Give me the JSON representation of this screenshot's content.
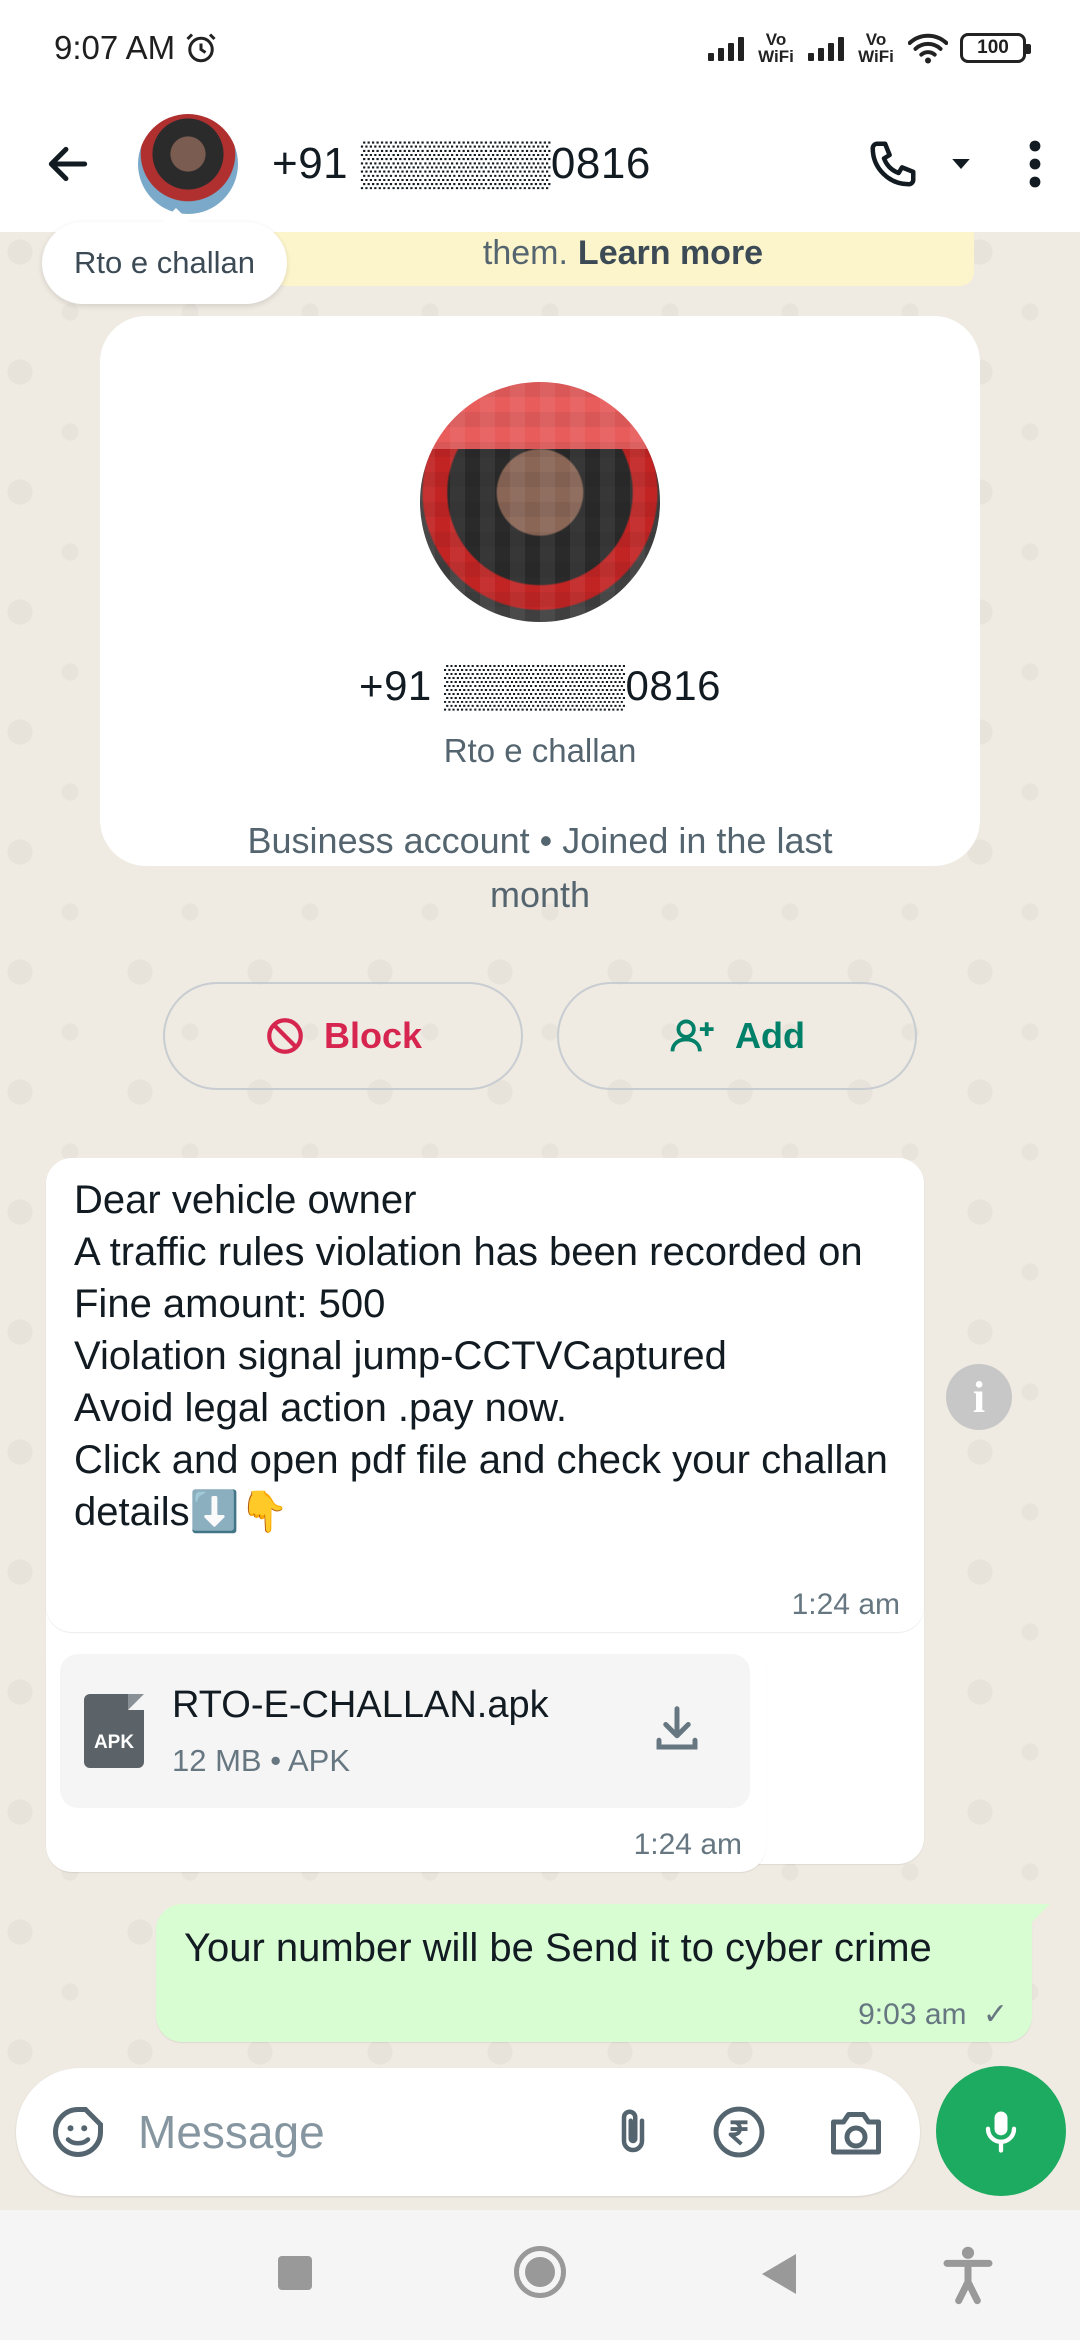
{
  "status_bar": {
    "time": "9:07 AM",
    "network_1": "Vo WiFi",
    "network_2": "Vo WiFi",
    "battery": "100"
  },
  "header": {
    "title": "+91 ▒▒▒▒▒▒0816",
    "icons": [
      "back-arrow-icon",
      "avatar",
      "phone-icon",
      "dropdown-icon",
      "more-vert-icon"
    ]
  },
  "tooltip": "Rto e challan",
  "encryption_banner": {
    "text": "them.",
    "link": "Learn more"
  },
  "profile_card": {
    "phone": "+91 ▒▒▒▒▒▒0816",
    "name": "Rto e challan",
    "info": "Business account • Joined in the last month",
    "block_label": "Block",
    "add_label": "Add",
    "colors": {
      "block": "#d6254f",
      "add": "#008069"
    }
  },
  "messages": [
    {
      "direction": "incoming",
      "text": "Dear vehicle owner\nA traffic rules violation has been recorded on\nFine amount: 500\nViolation signal jump-CCTVCaptured\nAvoid legal action .pay now.\nClick and open pdf file and check your challan details⬇️👇",
      "time": "1:24 am"
    },
    {
      "direction": "incoming",
      "file_name": "RTO-E-CHALLAN.apk",
      "file_meta": "12 MB • APK",
      "file_icon_label": "APK",
      "time": "1:24 am"
    },
    {
      "direction": "outgoing",
      "text": "Your number will be Send it to cyber crime",
      "time": "9:03 am",
      "status": "✓"
    }
  ],
  "input": {
    "placeholder": "Message"
  },
  "colors": {
    "accent": "#1daa61",
    "outgoing_bubble": "#d9fdd3",
    "chat_background": "#efeae2"
  }
}
